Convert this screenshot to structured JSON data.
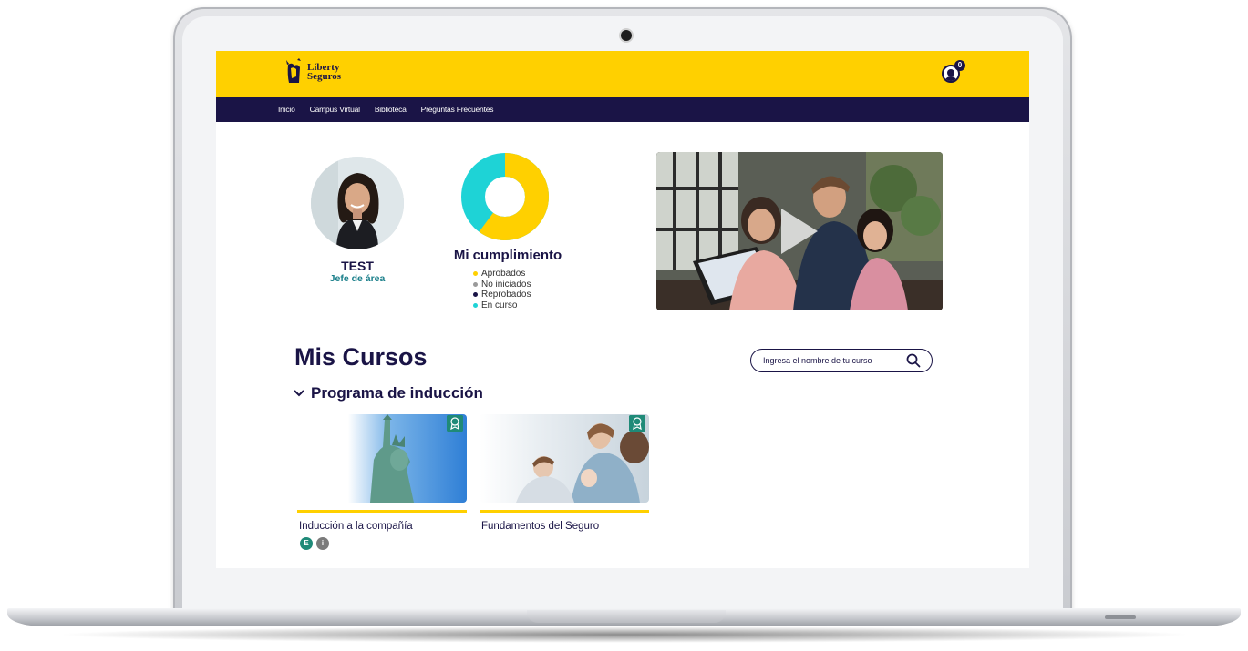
{
  "brand": {
    "line1": "Liberty",
    "line2": "Seguros",
    "primary_color": "#ffd000",
    "navy_color": "#1a1446",
    "teal_color": "#1a7f8a"
  },
  "header": {
    "notification_count": "0"
  },
  "nav": {
    "items": [
      "Inicio",
      "Campus Virtual",
      "Biblioteca",
      "Preguntas Frecuentes"
    ]
  },
  "profile": {
    "name": "TEST",
    "role": "Jefe de área"
  },
  "compliance": {
    "title": "Mi cumplimiento",
    "legend": [
      {
        "label": "Aprobados",
        "color": "#ffd000"
      },
      {
        "label": "No iniciados",
        "color": "#9a9a9a"
      },
      {
        "label": "Reprobados",
        "color": "#1a1446"
      },
      {
        "label": "En curso",
        "color": "#1ed3d6"
      }
    ]
  },
  "video": {
    "icon": "play-icon"
  },
  "courses": {
    "section_title": "Mis Cursos",
    "search_placeholder": "Ingresa el nombre de tu curso",
    "program_title": "Programa de inducción",
    "items": [
      {
        "title": "Inducción a la compañía",
        "tags": [
          "E",
          "i"
        ],
        "badge_icon": "award-icon"
      },
      {
        "title": "Fundamentos del Seguro",
        "tags": [],
        "badge_icon": "award-icon"
      }
    ]
  }
}
